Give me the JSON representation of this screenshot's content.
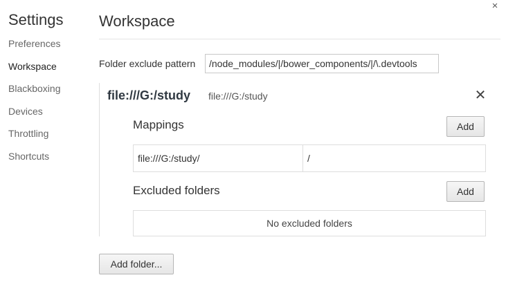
{
  "dialog": {
    "close_glyph": "×",
    "close_icon": "close-icon"
  },
  "sidebar": {
    "title": "Settings",
    "items": [
      {
        "label": "Preferences",
        "selected": false
      },
      {
        "label": "Workspace",
        "selected": true
      },
      {
        "label": "Blackboxing",
        "selected": false
      },
      {
        "label": "Devices",
        "selected": false
      },
      {
        "label": "Throttling",
        "selected": false
      },
      {
        "label": "Shortcuts",
        "selected": false
      }
    ]
  },
  "main": {
    "title": "Workspace",
    "exclude": {
      "label": "Folder exclude pattern",
      "value": "/node_modules/|/bower_components/|/\\.devtools"
    },
    "folder": {
      "name": "file:///G:/study",
      "path": "file:///G:/study",
      "remove_glyph": "✕",
      "mappings": {
        "title": "Mappings",
        "add_label": "Add",
        "rows": [
          {
            "url_prefix": "file:///G:/study/",
            "folder_path": "/"
          }
        ]
      },
      "excluded": {
        "title": "Excluded folders",
        "add_label": "Add",
        "empty_text": "No excluded folders"
      }
    },
    "add_folder_label": "Add folder..."
  },
  "colors": {
    "text": "#303942",
    "border": "#dddddd",
    "button_border": "#b5b5b5"
  }
}
